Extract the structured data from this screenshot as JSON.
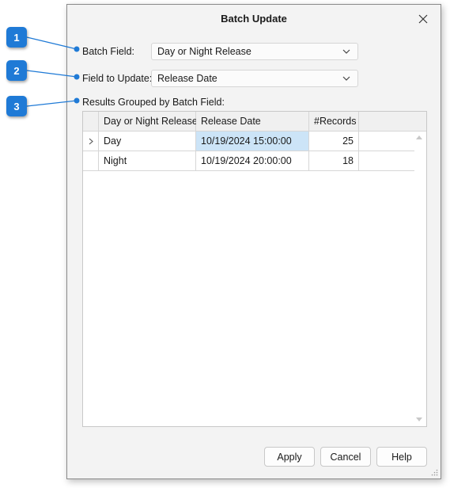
{
  "dialog": {
    "title": "Batch Update",
    "batch_field": {
      "label": "Batch Field:",
      "value": "Day or Night Release"
    },
    "field_to_update": {
      "label": "Field to Update:",
      "value": "Release Date"
    },
    "results_label": "Results Grouped by Batch Field:",
    "grid": {
      "columns": [
        "Day or Night Release",
        "Release Date",
        "#Records"
      ],
      "rows": [
        {
          "group": "Day",
          "release_date": "10/19/2024 15:00:00",
          "records": "25"
        },
        {
          "group": "Night",
          "release_date": "10/19/2024 20:00:00",
          "records": "18"
        }
      ]
    },
    "buttons": {
      "apply": "Apply",
      "cancel": "Cancel",
      "help": "Help"
    }
  },
  "callouts": [
    "1",
    "2",
    "3"
  ],
  "colors": {
    "callout": "#1f7ad6",
    "selection": "#cce4f7"
  }
}
